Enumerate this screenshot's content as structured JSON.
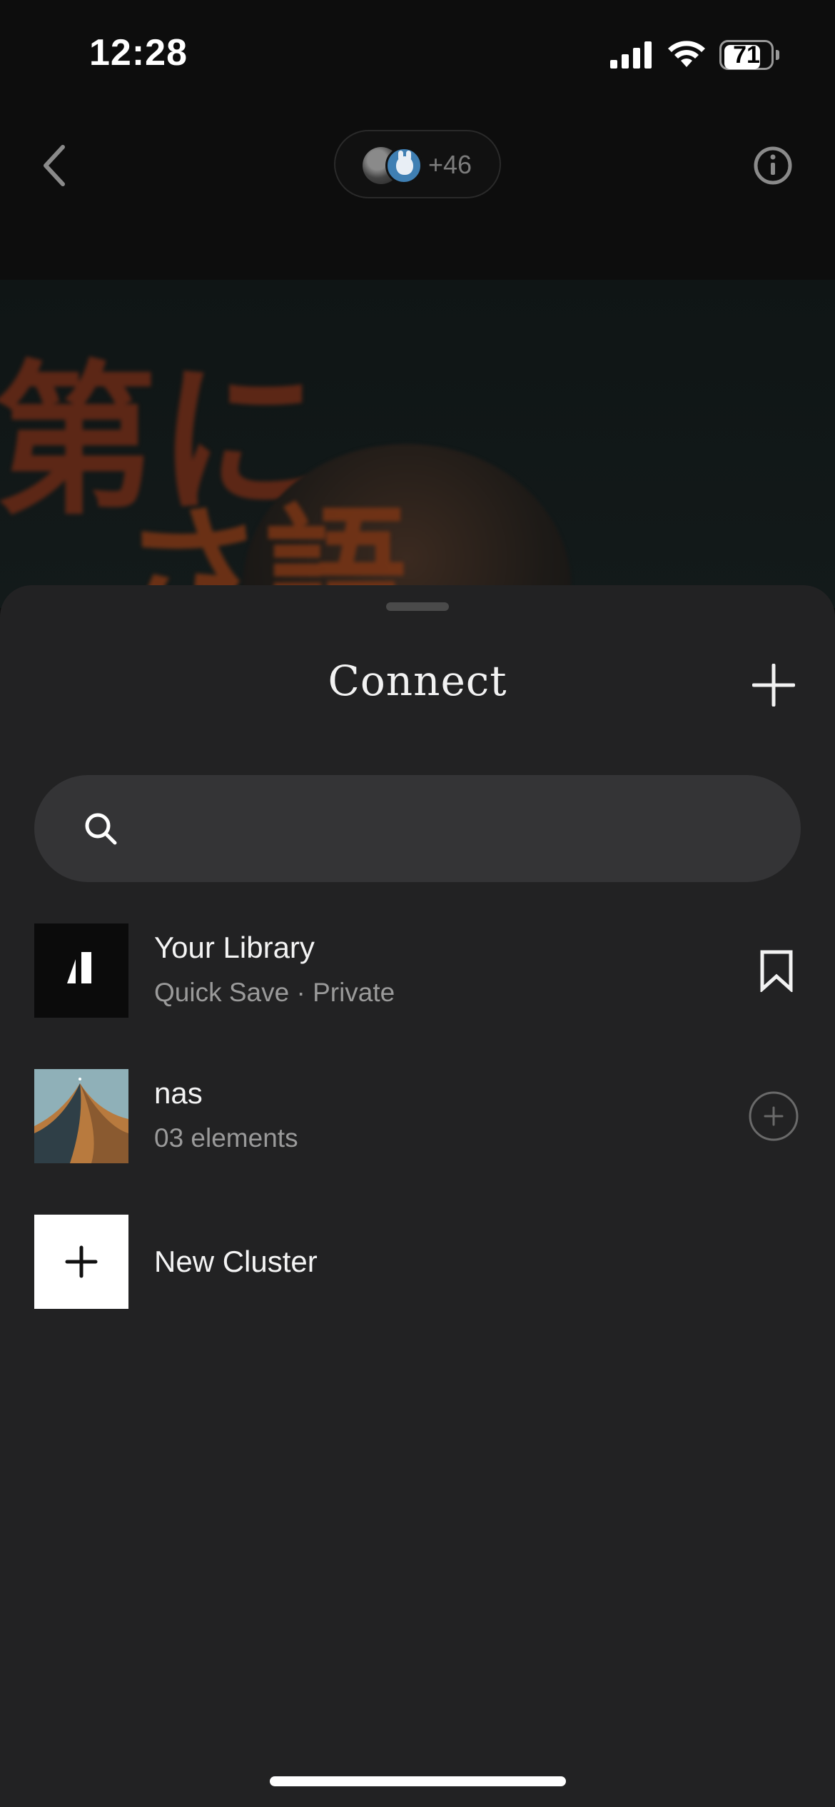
{
  "status_bar": {
    "time": "12:28",
    "battery": "71"
  },
  "header": {
    "collaborator_count": "+46"
  },
  "sheet": {
    "title": "Connect",
    "search": {
      "placeholder": ""
    },
    "items": [
      {
        "title": "Your Library",
        "subtitle": "Quick Save · Private",
        "action_icon": "bookmark-icon"
      },
      {
        "title": "nas",
        "subtitle": "03 elements",
        "action_icon": "plus-circle-icon"
      },
      {
        "title": "New Cluster",
        "icon": "plus-icon"
      }
    ]
  },
  "colors": {
    "sheet_background": "#222223",
    "search_background": "#343436",
    "muted_text": "#9a9a9a"
  }
}
